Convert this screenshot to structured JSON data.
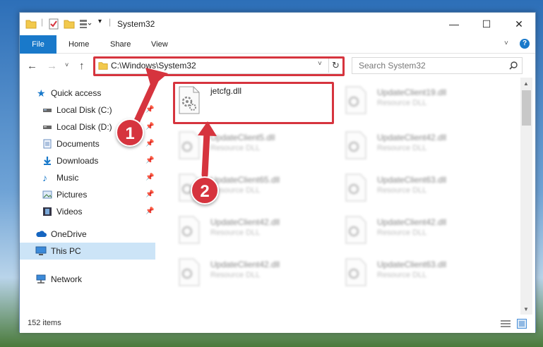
{
  "window": {
    "title": "System32"
  },
  "ribbon": {
    "tabs": [
      "File",
      "Home",
      "Share",
      "View"
    ]
  },
  "address": {
    "path": "C:\\Windows\\System32"
  },
  "search": {
    "placeholder": "Search System32"
  },
  "sidebar": {
    "items": [
      {
        "label": "Quick access",
        "icon": "star-icon"
      },
      {
        "label": "Local Disk (C:)",
        "icon": "drive-icon",
        "pinned": true
      },
      {
        "label": "Local Disk (D:)",
        "icon": "drive-icon",
        "pinned": true
      },
      {
        "label": "Documents",
        "icon": "documents-icon",
        "pinned": true
      },
      {
        "label": "Downloads",
        "icon": "download-icon",
        "pinned": true
      },
      {
        "label": "Music",
        "icon": "music-icon",
        "pinned": true
      },
      {
        "label": "Pictures",
        "icon": "pictures-icon",
        "pinned": true
      },
      {
        "label": "Videos",
        "icon": "videos-icon",
        "pinned": true
      },
      {
        "label": "OneDrive",
        "icon": "cloud-icon"
      },
      {
        "label": "This PC",
        "icon": "computer-icon",
        "selected": true
      },
      {
        "label": "Network",
        "icon": "network-icon"
      }
    ]
  },
  "files": [
    {
      "name": "jetcfg.dll",
      "type": ""
    },
    {
      "name": "UpdateClient19.dll",
      "type": "Resource DLL"
    },
    {
      "name": "UpdateClient5.dll",
      "type": "Resource DLL"
    },
    {
      "name": "UpdateClient42.dll",
      "type": "Resource DLL"
    },
    {
      "name": "UpdateClient65.dll",
      "type": "Resource DLL"
    },
    {
      "name": "UpdateClient63.dll",
      "type": "Resource DLL"
    },
    {
      "name": "UpdateClient42.dll",
      "type": "Resource DLL"
    },
    {
      "name": "UpdateClient42.dll",
      "type": "Resource DLL"
    },
    {
      "name": "UpdateClient42.dll",
      "type": "Resource DLL"
    },
    {
      "name": "UpdateClient63.dll",
      "type": "Resource DLL"
    }
  ],
  "status": {
    "item_count": "152 items"
  },
  "callouts": [
    "1",
    "2"
  ],
  "colors": {
    "accent": "#1979ca",
    "highlight": "#d6343e",
    "selected": "#cce4f7"
  }
}
